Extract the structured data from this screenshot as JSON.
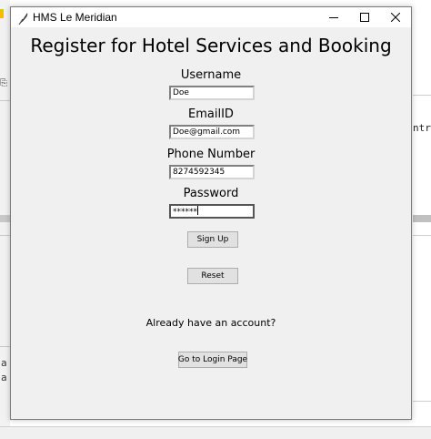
{
  "window": {
    "title": "HMS Le Meridian"
  },
  "form": {
    "heading": "Register for Hotel Services and Booking",
    "username_label": "Username",
    "username_value": "Doe",
    "email_label": "EmailID",
    "email_value": "Doe@gmail.com",
    "phone_label": "Phone Number",
    "phone_value": "8274592345",
    "password_label": "Password",
    "password_value": "******",
    "signup_label": "Sign Up",
    "reset_label": "Reset",
    "account_prompt": "Already have an account?",
    "login_label": "Go to Login Page"
  },
  "background": {
    "right_text": "ntro",
    "left_text_1": "a",
    "left_text_2": "a"
  },
  "colors": {
    "window_bg": "#f0f0f0",
    "button_bg": "#e1e1e1"
  }
}
